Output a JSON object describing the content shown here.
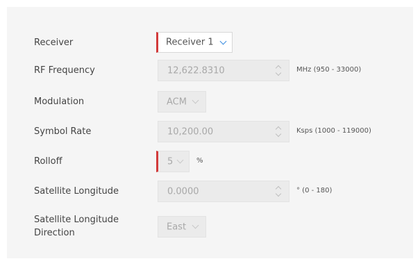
{
  "fields": {
    "receiver": {
      "label": "Receiver",
      "value": "Receiver 1"
    },
    "rf_frequency": {
      "label": "RF Frequency",
      "value": "12,622.8310",
      "unit": "MHz (950 - 33000)"
    },
    "modulation": {
      "label": "Modulation",
      "value": "ACM"
    },
    "symbol_rate": {
      "label": "Symbol Rate",
      "value": "10,200.00",
      "unit": "Ksps (1000 - 119000)"
    },
    "rolloff": {
      "label": "Rolloff",
      "value": "5",
      "unit": "%"
    },
    "satellite_longitude": {
      "label": "Satellite Longitude",
      "value": "0.0000",
      "unit": "° (0 - 180)"
    },
    "satellite_longitude_direction": {
      "label_line1": "Satellite Longitude",
      "label_line2": "Direction",
      "value": "East"
    }
  },
  "colors": {
    "panel_background": "#f5f5f5",
    "required_marker": "#d23a3a",
    "dropdown_accent": "#3a8de0",
    "disabled_field": "#ebebeb"
  },
  "icons": {
    "dropdown": "chevron-down-icon",
    "spinner_up": "chevron-up-icon",
    "spinner_down": "chevron-down-icon"
  }
}
